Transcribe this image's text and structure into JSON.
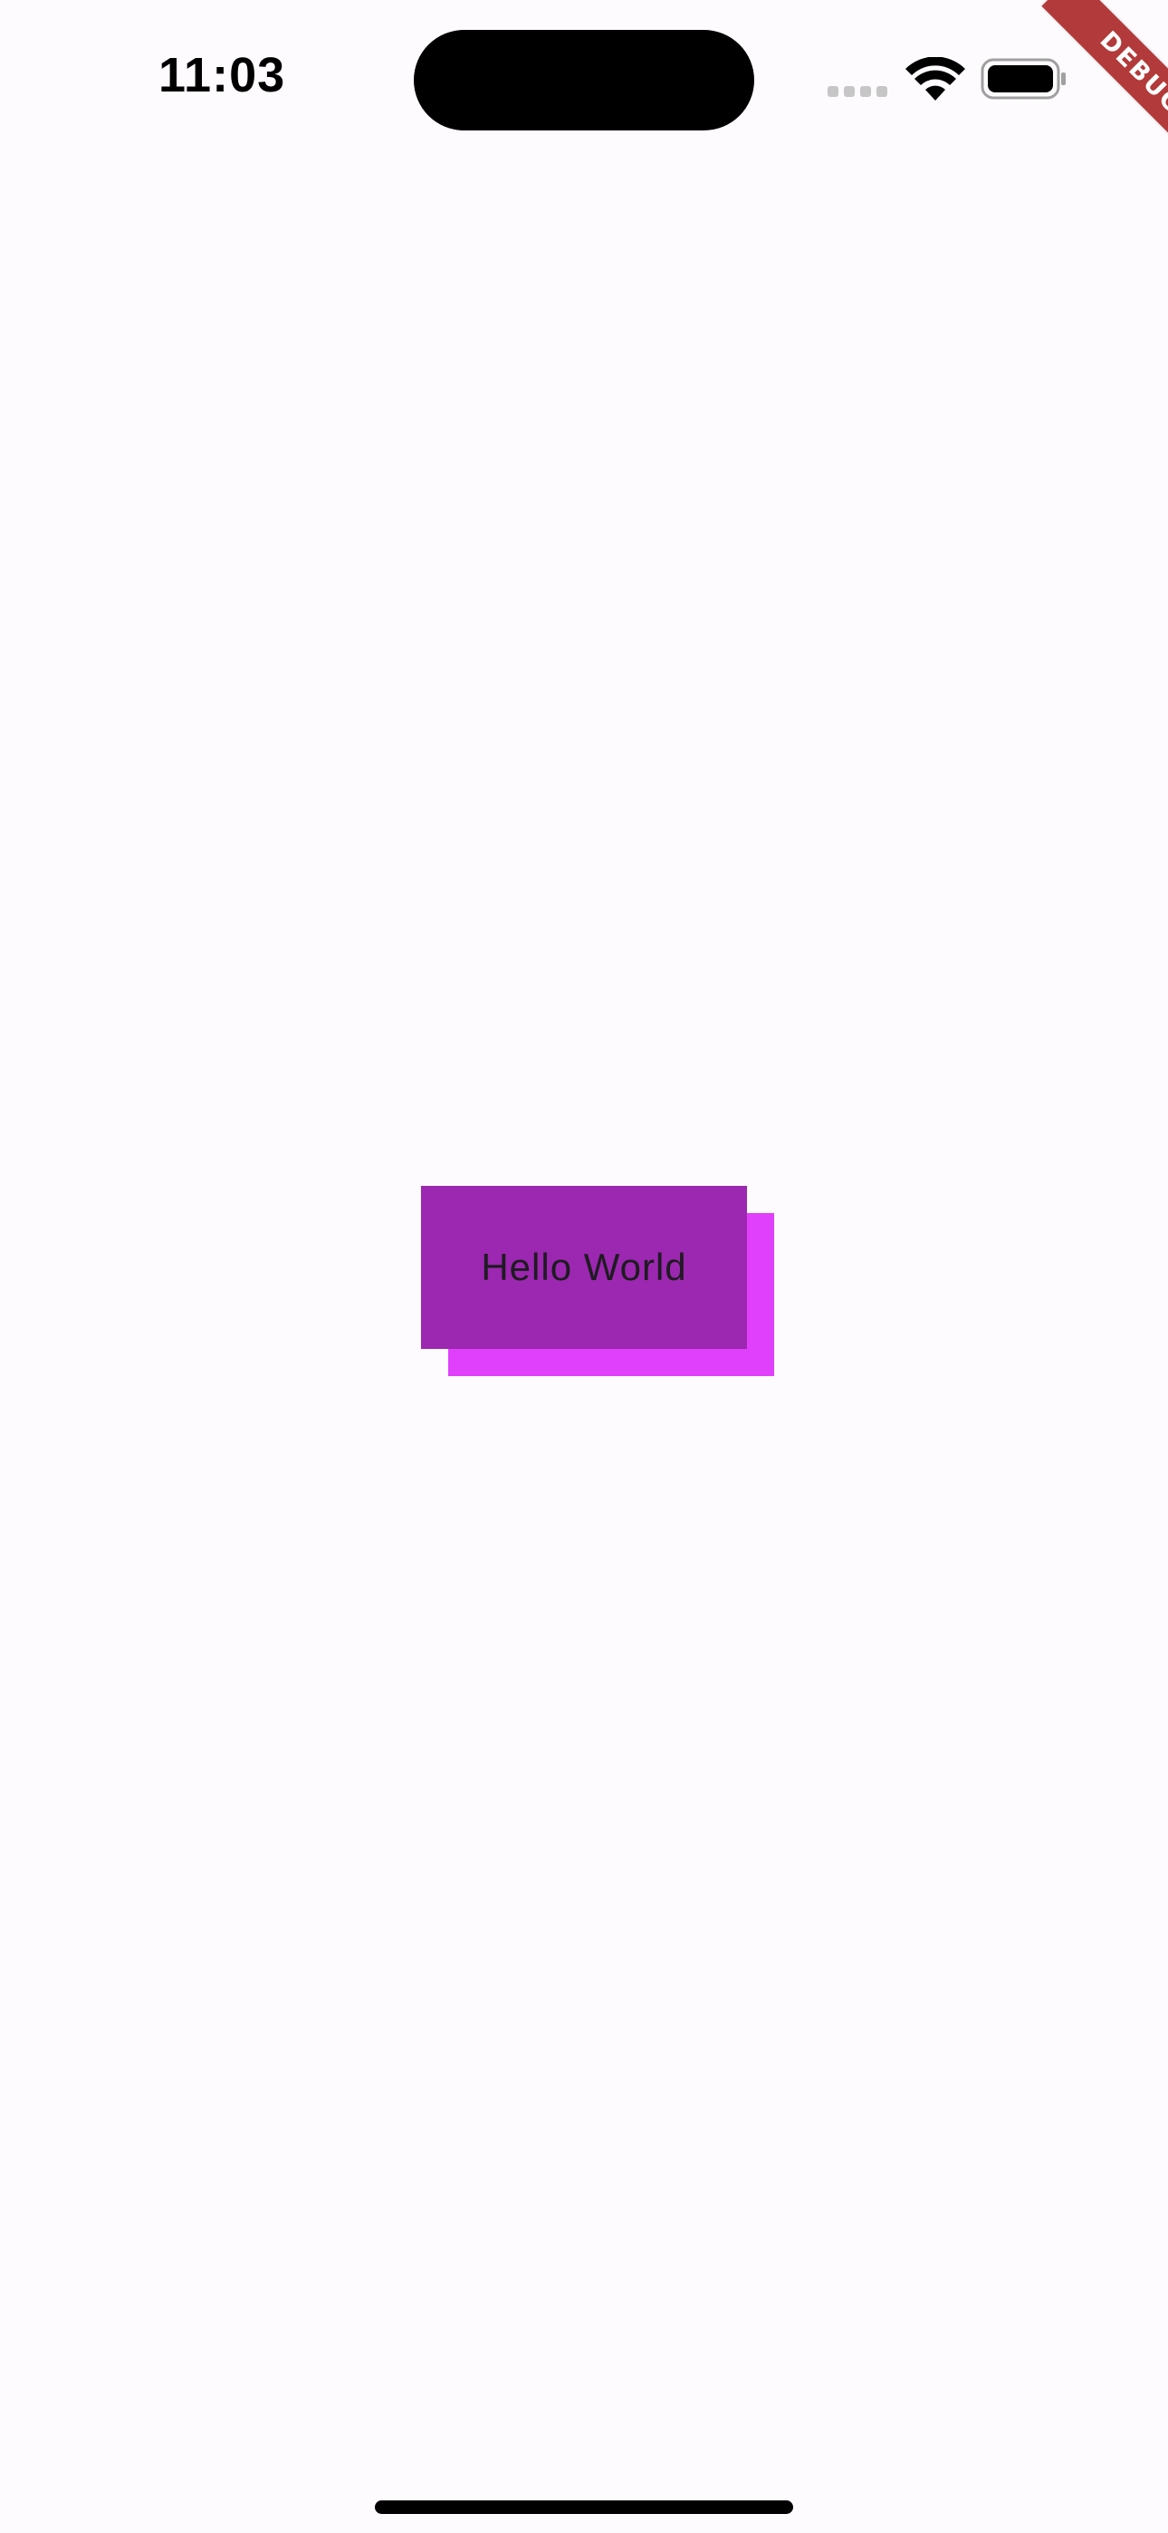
{
  "status_bar": {
    "time": "11:03"
  },
  "debug_banner": {
    "label": "DEBUG",
    "color": "#b23a3a"
  },
  "main": {
    "greeting": "Hello World",
    "front_box_color": "#9c27b0",
    "back_box_color": "#e040fb"
  },
  "colors": {
    "background": "#fefbfe"
  }
}
